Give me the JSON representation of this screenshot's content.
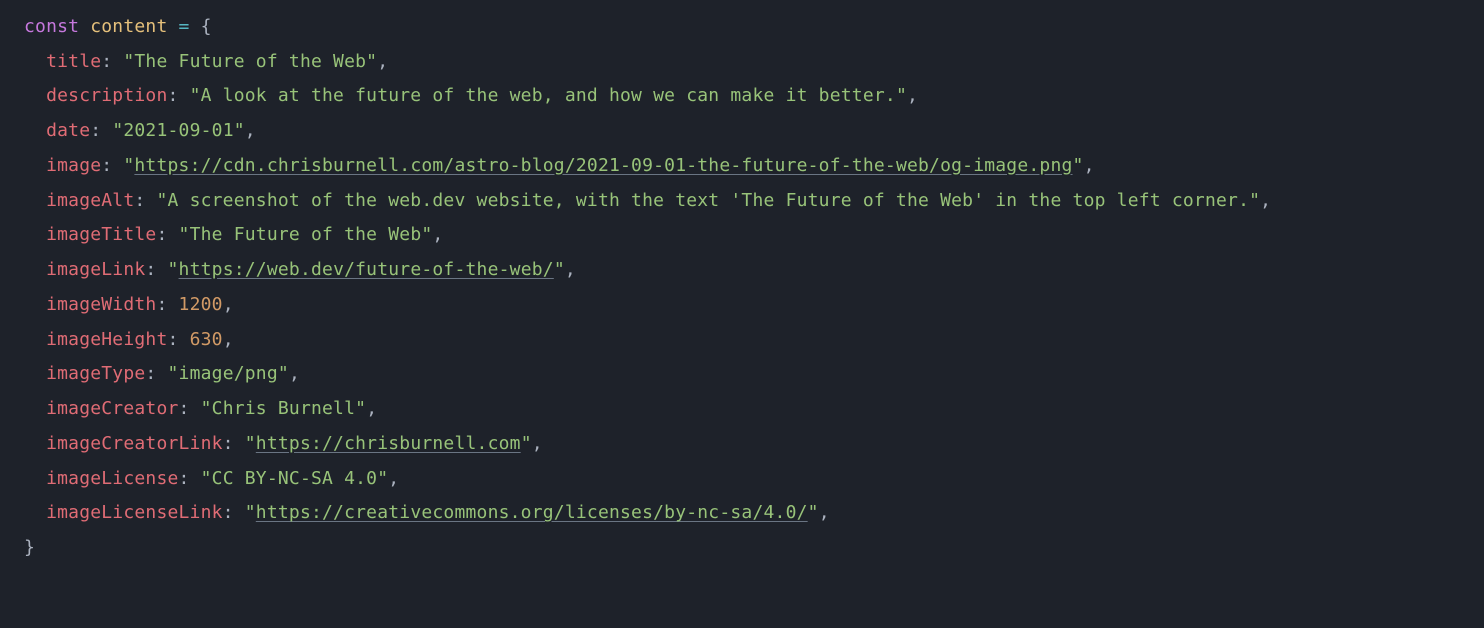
{
  "code": {
    "kw_const": "const",
    "varname": "content",
    "eq": "=",
    "lbrace": "{",
    "rbrace": "}",
    "props": {
      "title": {
        "key": "title",
        "val": "The Future of the Web"
      },
      "description": {
        "key": "description",
        "val": "A look at the future of the web, and how we can make it better."
      },
      "date": {
        "key": "date",
        "val": "2021-09-01"
      },
      "image": {
        "key": "image",
        "val": "https://cdn.chrisburnell.com/astro-blog/2021-09-01-the-future-of-the-web/og-image.png"
      },
      "imageAlt": {
        "key": "imageAlt",
        "val": "A screenshot of the web.dev website, with the text 'The Future of the Web' in the top left corner."
      },
      "imageTitle": {
        "key": "imageTitle",
        "val": "The Future of the Web"
      },
      "imageLink": {
        "key": "imageLink",
        "val": "https://web.dev/future-of-the-web/"
      },
      "imageWidth": {
        "key": "imageWidth",
        "val": "1200"
      },
      "imageHeight": {
        "key": "imageHeight",
        "val": "630"
      },
      "imageType": {
        "key": "imageType",
        "val": "image/png"
      },
      "imageCreator": {
        "key": "imageCreator",
        "val": "Chris Burnell"
      },
      "imageCreatorLink": {
        "key": "imageCreatorLink",
        "val": "https://chrisburnell.com"
      },
      "imageLicense": {
        "key": "imageLicense",
        "val": "CC BY-NC-SA 4.0"
      },
      "imageLicenseLink": {
        "key": "imageLicenseLink",
        "val": "https://creativecommons.org/licenses/by-nc-sa/4.0/"
      }
    }
  }
}
